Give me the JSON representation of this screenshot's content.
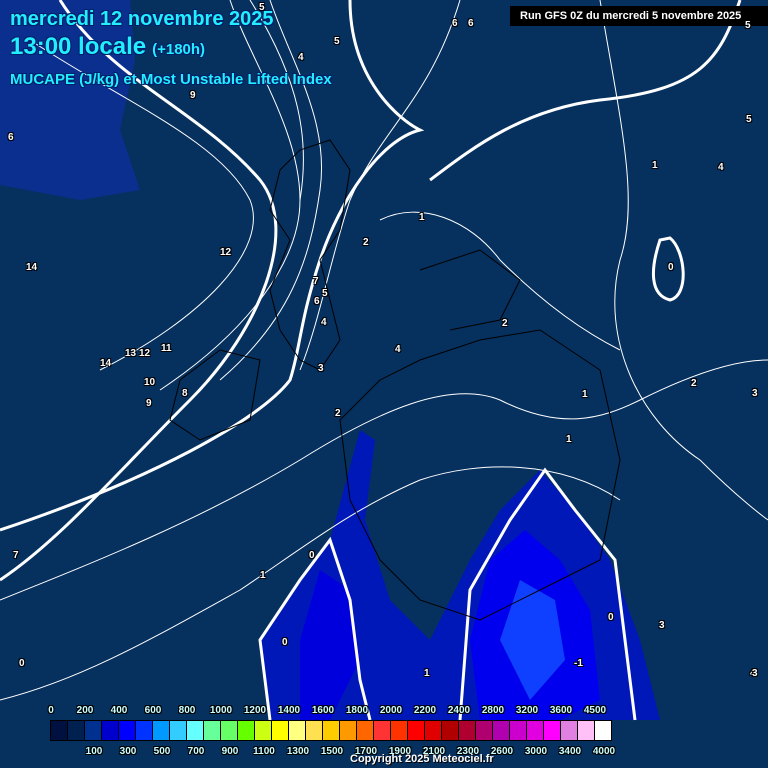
{
  "header": {
    "date": "mercredi 12 novembre 2025",
    "time": "13:00 locale",
    "lead": "(+180h)",
    "title": "MUCAPE (J/kg) et Most Unstable Lifted Index",
    "run": "Run GFS 0Z du mercredi 5 novembre 2025"
  },
  "contour_labels": [
    "5",
    "4",
    "5",
    "6",
    "6",
    "9",
    "6",
    "5",
    "5",
    "1",
    "4",
    "12",
    "14",
    "1",
    "2",
    "0",
    "7",
    "5",
    "6",
    "4",
    "2",
    "4",
    "13",
    "12",
    "11",
    "14",
    "10",
    "9",
    "8",
    "3",
    "2",
    "1",
    "2",
    "1",
    "3",
    "0",
    "7",
    "1",
    "0",
    "0",
    "3",
    "1",
    "-1",
    "0",
    "4",
    "3"
  ],
  "legend": {
    "top_labels": [
      "0",
      "200",
      "400",
      "600",
      "800",
      "1000",
      "1200",
      "1400",
      "1600",
      "1800",
      "2000",
      "2200",
      "2400",
      "2800",
      "3200",
      "3600",
      "4500"
    ],
    "bottom_labels": [
      "100",
      "300",
      "500",
      "700",
      "900",
      "1100",
      "1300",
      "1500",
      "1700",
      "1900",
      "2100",
      "2300",
      "2600",
      "3000",
      "3400",
      "4000"
    ],
    "colors": [
      "#001040",
      "#002050",
      "#003090",
      "#0000cc",
      "#0000ff",
      "#0033ff",
      "#0099ff",
      "#33ccff",
      "#66ffff",
      "#66ff99",
      "#66ff66",
      "#66ff00",
      "#ccff11",
      "#ffff00",
      "#ffff80",
      "#ffe050",
      "#ffcc00",
      "#ff9900",
      "#ff6600",
      "#ff3333",
      "#ff3300",
      "#ff0000",
      "#e00000",
      "#b00000",
      "#b00030",
      "#b00070",
      "#b000b0",
      "#cc00cc",
      "#e000e0",
      "#ff00ff",
      "#e080e0",
      "#ffc0f8",
      "#ffffff"
    ]
  },
  "copyright": "Copyright 2025 Meteociel.fr"
}
